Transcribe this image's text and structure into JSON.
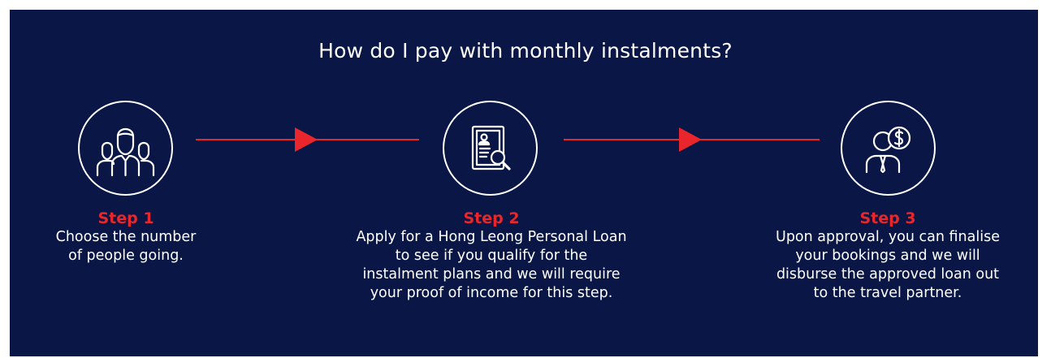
{
  "title": "How do I pay with monthly instalments?",
  "colors": {
    "background": "#0a1746",
    "accent": "#e8262b",
    "text": "#ffffff"
  },
  "steps": [
    {
      "label": "Step 1",
      "icon": "people-group-icon",
      "description_lines": [
        "Choose the number",
        "of people going."
      ]
    },
    {
      "label": "Step 2",
      "icon": "document-search-icon",
      "description_lines": [
        "Apply for a Hong Leong Personal Loan",
        "to see if you qualify for the",
        "instalment plans and we will require",
        "your proof of income for this step."
      ]
    },
    {
      "label": "Step 3",
      "icon": "person-money-icon",
      "description_lines": [
        "Upon approval, you can finalise",
        "your bookings and we will",
        "disburse the approved loan out",
        "to the travel partner."
      ]
    }
  ]
}
